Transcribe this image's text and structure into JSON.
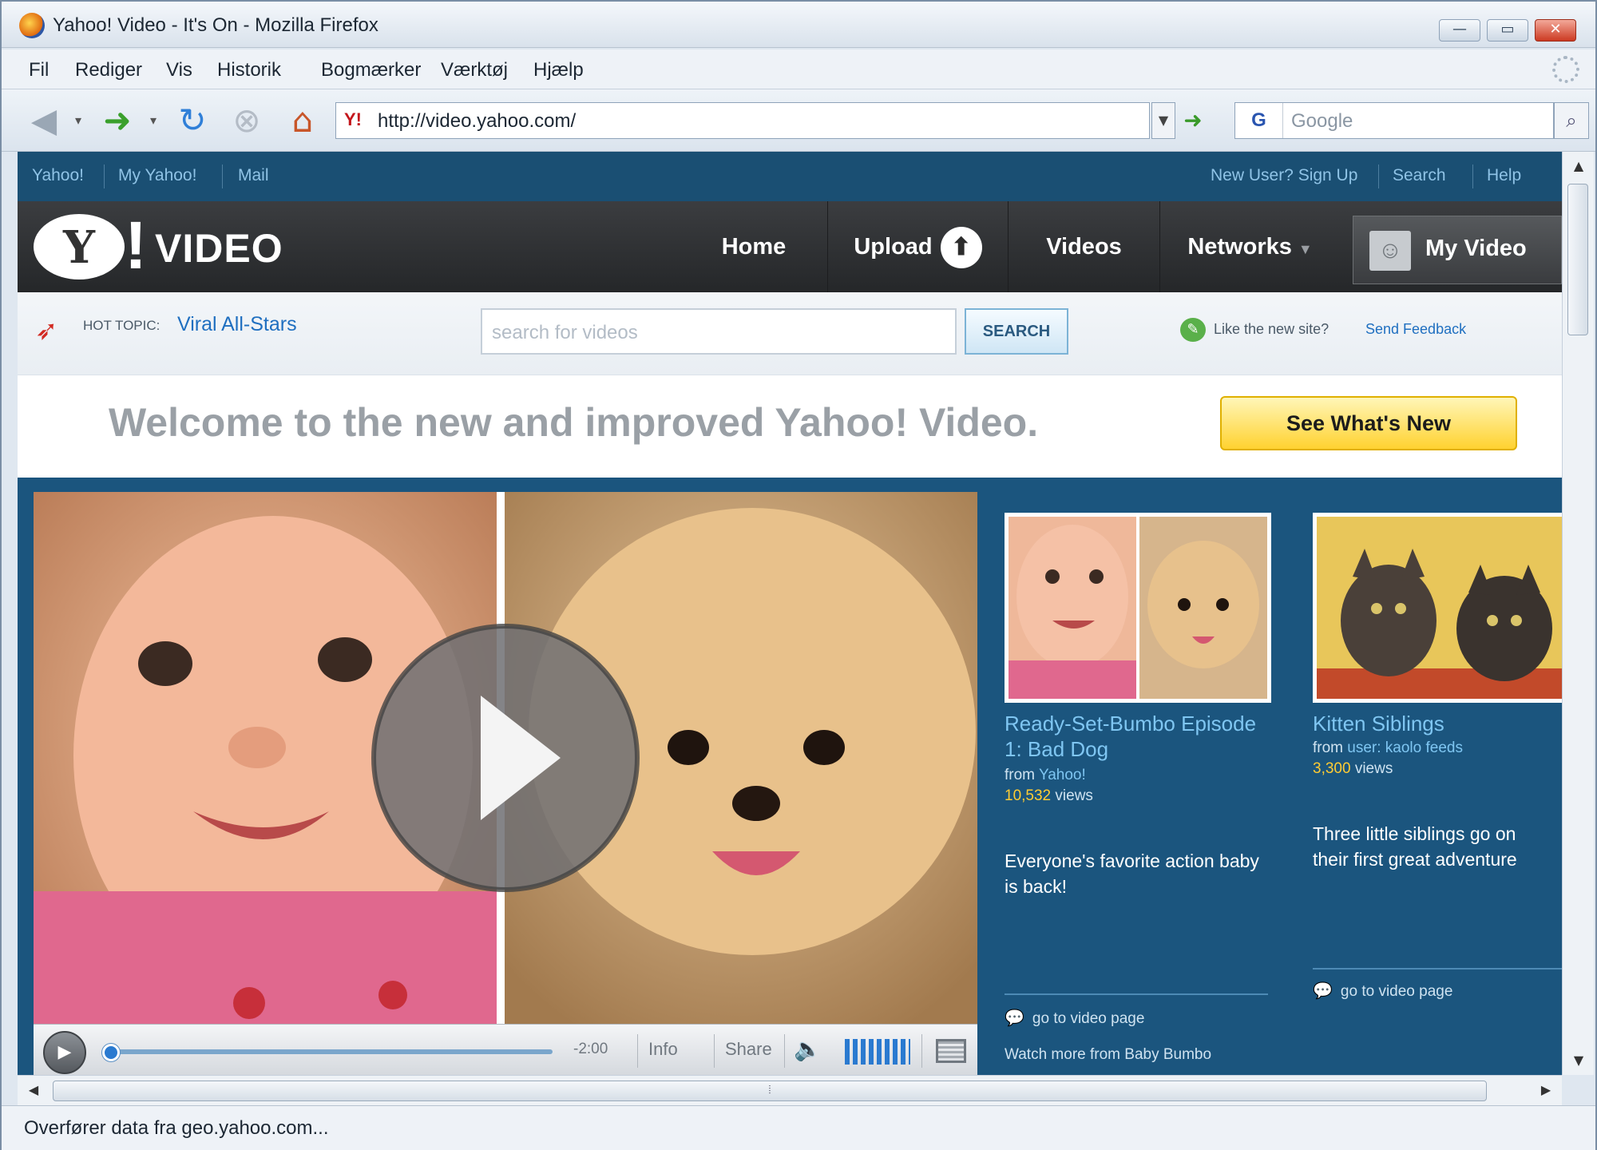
{
  "window": {
    "title": "Yahoo! Video - It's On - Mozilla Firefox",
    "minimize": "—",
    "maximize": "▭",
    "close": "✕"
  },
  "menu": [
    {
      "label": "Fil"
    },
    {
      "label": "Rediger"
    },
    {
      "label": "Vis"
    },
    {
      "label": "Historik"
    },
    {
      "label": "Bogmærker"
    },
    {
      "label": "Værktøj"
    },
    {
      "label": "Hjælp"
    }
  ],
  "navbar": {
    "url": "http://video.yahoo.com/",
    "url_favicon": "Y!",
    "search_engine": "G",
    "search_placeholder": "Google"
  },
  "status": "Overfører data fra geo.yahoo.com...",
  "yahoo_bar": {
    "left": [
      {
        "label": "Yahoo!"
      },
      {
        "label": "My Yahoo!"
      },
      {
        "label": "Mail"
      }
    ],
    "right": [
      {
        "label": "New User? Sign Up"
      },
      {
        "label": "Search"
      },
      {
        "label": "Help"
      }
    ]
  },
  "header": {
    "logo_y": "Y",
    "logo_bang": "!",
    "logo_text": "VIDEO",
    "nav": {
      "home": "Home",
      "upload": "Upload",
      "videos": "Videos",
      "networks": "Networks",
      "my_video": "My Video"
    }
  },
  "search_row": {
    "hot_label": "HOT TOPIC:",
    "hot_link": "Viral All-Stars",
    "placeholder": "search for videos",
    "button": "SEARCH",
    "feedback_text": "Like the new site?",
    "feedback_link": "Send Feedback"
  },
  "welcome": {
    "text": "Welcome to the new and improved Yahoo! Video.",
    "button": "See What's New"
  },
  "player": {
    "time": "-2:00",
    "info": "Info",
    "share": "Share"
  },
  "featured": [
    {
      "title": "Ready-Set-Bumbo Episode 1: Bad Dog",
      "from_label": "from",
      "source": "Yahoo!",
      "views_count": "10,532",
      "views_label": "views",
      "description": "Everyone's favorite action baby is back!",
      "link": "go to video page",
      "watch_more": "Watch more from Baby Bumbo"
    },
    {
      "title": "Kitten Siblings",
      "from_label": "from",
      "source": "user: kaolo feeds",
      "views_count": "3,300",
      "views_label": "views",
      "description": "Three little siblings go on their first great adventure",
      "link": "go to video page"
    }
  ]
}
